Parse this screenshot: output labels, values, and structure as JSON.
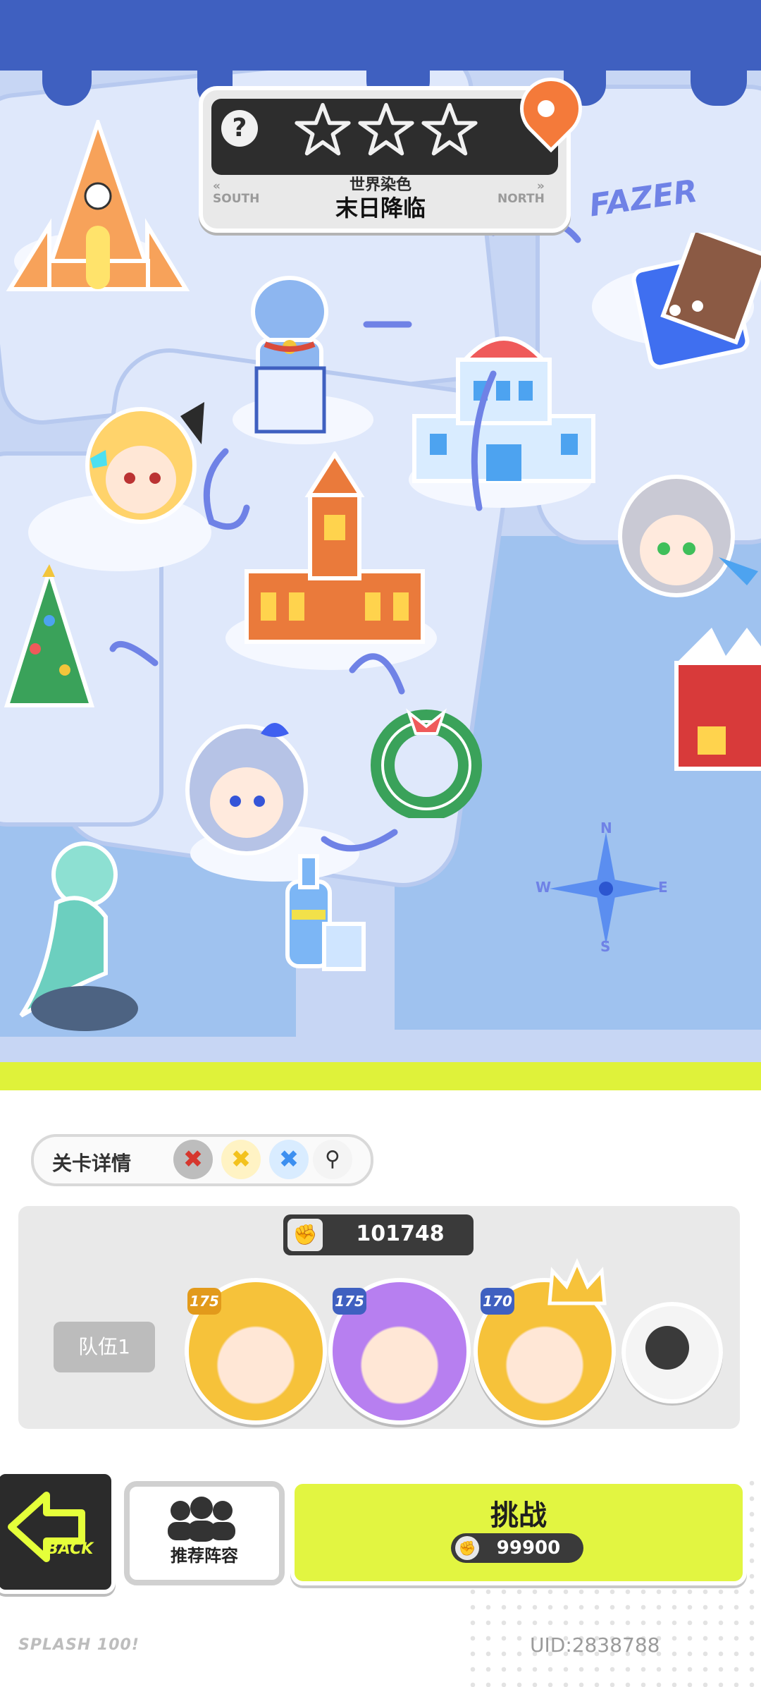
{
  "level": {
    "subtitle": "世界染色",
    "title": "末日降临",
    "nav_left": "SOUTH",
    "nav_right": "NORTH",
    "stars_earned": 0,
    "stars_total": 3,
    "help_symbol": "?"
  },
  "map": {
    "brand_sign": "FAZER",
    "compass": {
      "n": "N",
      "s": "S",
      "e": "E",
      "w": "W"
    }
  },
  "details": {
    "label": "关卡详情",
    "chips": [
      {
        "icon": "red-x-chip-icon",
        "color": "#d6372e"
      },
      {
        "icon": "yellow-x-chip-icon",
        "color": "#f3c21d"
      },
      {
        "icon": "blue-x-chip-icon",
        "color": "#3c8ff0"
      },
      {
        "icon": "magnifier-icon",
        "color": "#333333"
      }
    ]
  },
  "team": {
    "power": "101748",
    "label": "队伍1",
    "heroes": [
      {
        "level": "175",
        "frame": "#f6c23a"
      },
      {
        "level": "175",
        "frame": "#b77ff0"
      },
      {
        "level": "170",
        "frame": "#f6c23a"
      }
    ]
  },
  "buttons": {
    "back": "BACK",
    "recommend": "推荐阵容",
    "fight": "挑战",
    "fight_cost": "99900"
  },
  "footer": {
    "logo": "SPLASH 100!",
    "uid": "UID:2838788"
  },
  "colors": {
    "accent": "#e2f541",
    "sky": "#3f60c0",
    "map_land": "#dfe8fb",
    "map_water": "#9fc2ef"
  }
}
